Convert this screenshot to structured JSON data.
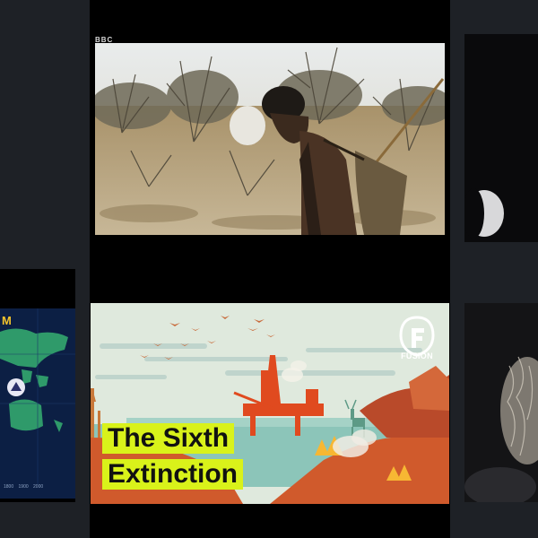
{
  "cards": {
    "top_video": {
      "watermark": "BBC"
    },
    "sixth_extinction": {
      "title_line1": "The Sixth",
      "title_line2": "Extinction",
      "channel_logo": "FUSION",
      "accent_color": "#d9f21a",
      "brand_color": "#e04a1f"
    },
    "map_video": {
      "partial_title": "M",
      "axis_ticks": "1800 1900 2000"
    }
  }
}
